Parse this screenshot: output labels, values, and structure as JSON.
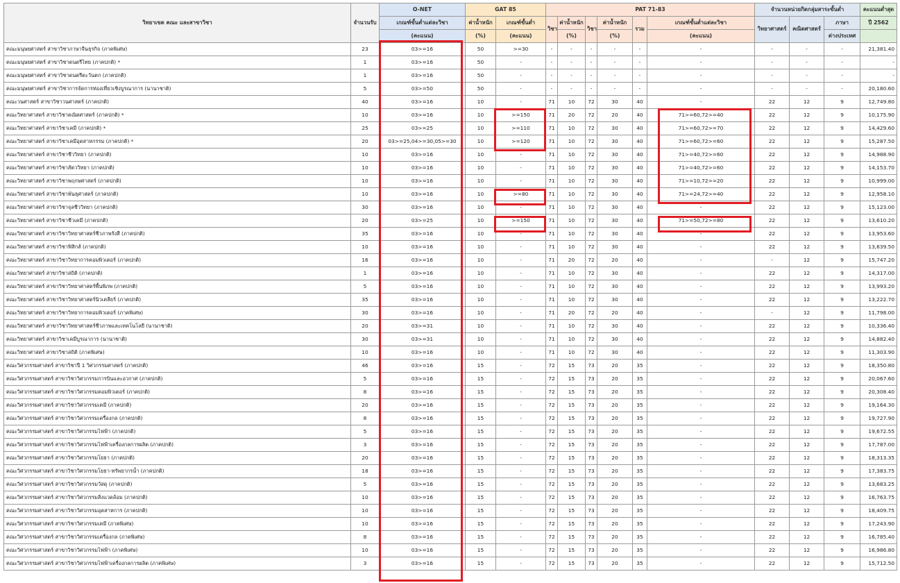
{
  "headers": {
    "program": "วิทยาเขต คณะ และสาขาวิชา",
    "seats": "จำนวนรับ",
    "onet": "O-NET",
    "onet_min": "เกณฑ์ขั้นต่ำแต่ละวิชา",
    "onet_unit": "(คะแนน)",
    "gat": "GAT 85",
    "gat_weight": "ค่าน้ำหนัก",
    "gat_weight_unit": "(%)",
    "gat_min": "เกณฑ์ขั้นต่ำ",
    "gat_min_unit": "(คะแนน)",
    "pat": "PAT 71-83",
    "subject": "วิชา",
    "weight": "ค่าน้ำหนัก",
    "weight_unit": "(%)",
    "total": "รวม",
    "pat_min": "เกณฑ์ขั้นต่ำแต่ละวิชา",
    "pat_min_unit": "(คะแนน)",
    "credits": "จำนวนหน่วยกิตกลุ่มสาระขั้นต่ำ",
    "science": "วิทยาศาสตร์",
    "math": "คณิตศาสตร์",
    "foreign": "ภาษา",
    "foreign2": "ต่างประเทศ",
    "min_score": "คะแนนต่ำสุด",
    "min_score_year": "ปี 2562"
  },
  "rows": [
    [
      "คณะมนุษยศาสตร์ สาขาวิชาภาษาจีนธุรกิจ (ภาคพิเศษ)",
      "23",
      "03>=16",
      "50",
      ">=30",
      "-",
      "-",
      "-",
      "-",
      "-",
      "-",
      "-",
      "-",
      "-",
      "21,381.40"
    ],
    [
      "คณะมนุษยศาสตร์ สาขาวิชาดนตรีไทย (ภาคปกติ) *",
      "1",
      "03>=16",
      "50",
      "-",
      "-",
      "-",
      "-",
      "-",
      "-",
      "-",
      "-",
      "-",
      "-",
      "-"
    ],
    [
      "คณะมนุษยศาสตร์ สาขาวิชาดนตรีตะวันตก (ภาคปกติ)",
      "1",
      "03>=16",
      "50",
      "-",
      "-",
      "-",
      "-",
      "-",
      "-",
      "-",
      "-",
      "-",
      "-",
      "-"
    ],
    [
      "คณะมนุษยศาสตร์ สาขาวิชาการจัดการท่องเที่ยวเชิงบูรณาการ (นานาชาติ)",
      "5",
      "03>=50",
      "50",
      "-",
      "-",
      "-",
      "-",
      "-",
      "-",
      "-",
      "-",
      "-",
      "-",
      "20,180.60"
    ],
    [
      "คณะวนศาสตร์ สาขาวิชาวนศาสตร์ (ภาคปกติ)",
      "40",
      "03>=16",
      "10",
      "-",
      "71",
      "10",
      "72",
      "30",
      "40",
      "-",
      "22",
      "12",
      "9",
      "12,749.80"
    ],
    [
      "คณะวิทยาศาสตร์ สาขาวิชาคณิตศาสตร์ (ภาคปกติ) *",
      "10",
      "03>=16",
      "10",
      ">=150",
      "71",
      "20",
      "72",
      "20",
      "40",
      "71>=60,72>=40",
      "22",
      "12",
      "9",
      "10,175.90"
    ],
    [
      "คณะวิทยาศาสตร์ สาขาวิชาเคมี (ภาคปกติ) *",
      "25",
      "03>=25",
      "10",
      ">=110",
      "71",
      "10",
      "72",
      "30",
      "40",
      "71>=60,72>=70",
      "22",
      "12",
      "9",
      "14,429.60"
    ],
    [
      "คณะวิทยาศาสตร์ สาขาวิชาเคมีอุตสาหกรรม (ภาคปกติ) *",
      "20",
      "03>=25,04>=30,05>=30",
      "10",
      ">=120",
      "71",
      "10",
      "72",
      "30",
      "40",
      "71>=60,72>=60",
      "22",
      "12",
      "9",
      "15,287.50"
    ],
    [
      "คณะวิทยาศาสตร์ สาขาวิชาชีววิทยา (ภาคปกติ)",
      "10",
      "03>=16",
      "10",
      "-",
      "71",
      "10",
      "72",
      "30",
      "40",
      "71>=40,72>=60",
      "22",
      "12",
      "9",
      "14,988.90"
    ],
    [
      "คณะวิทยาศาสตร์ สาขาวิชาสัตววิทยา (ภาคปกติ)",
      "10",
      "03>=16",
      "10",
      "-",
      "71",
      "10",
      "72",
      "30",
      "40",
      "71>=40,72>=60",
      "22",
      "12",
      "9",
      "14,153.70"
    ],
    [
      "คณะวิทยาศาสตร์ สาขาวิชาพฤกษศาสตร์ (ภาคปกติ)",
      "10",
      "03>=16",
      "10",
      "-",
      "71",
      "10",
      "72",
      "30",
      "40",
      "71>=10,72>=20",
      "22",
      "12",
      "9",
      "10,999.00"
    ],
    [
      "คณะวิทยาศาสตร์ สาขาวิชาพันธุศาสตร์ (ภาคปกติ)",
      "10",
      "03>=16",
      "10",
      ">=80",
      "71",
      "10",
      "72",
      "30",
      "40",
      "71>=24,72>=40",
      "22",
      "12",
      "9",
      "12,958.10"
    ],
    [
      "คณะวิทยาศาสตร์ สาขาวิชาจุลชีววิทยา (ภาคปกติ)",
      "30",
      "03>=16",
      "10",
      "-",
      "71",
      "10",
      "72",
      "30",
      "40",
      "-",
      "22",
      "12",
      "9",
      "15,123.00"
    ],
    [
      "คณะวิทยาศาสตร์ สาขาวิชาชีวเคมี (ภาคปกติ)",
      "20",
      "03>=25",
      "10",
      ">=150",
      "71",
      "10",
      "72",
      "30",
      "40",
      "71>=50,72>=80",
      "22",
      "12",
      "9",
      "13,610.20"
    ],
    [
      "คณะวิทยาศาสตร์ สาขาวิชาวิทยาศาสตร์ชีวภาพรังสี (ภาคปกติ)",
      "35",
      "03>=16",
      "10",
      "-",
      "71",
      "10",
      "72",
      "30",
      "40",
      "-",
      "22",
      "12",
      "9",
      "13,953.60"
    ],
    [
      "คณะวิทยาศาสตร์ สาขาวิชาฟิสิกส์ (ภาคปกติ)",
      "10",
      "03>=16",
      "10",
      "-",
      "71",
      "10",
      "72",
      "30",
      "40",
      "-",
      "22",
      "12",
      "9",
      "13,639.50"
    ],
    [
      "คณะวิทยาศาสตร์ สาขาวิชาวิทยาการคอมพิวเตอร์ (ภาคปกติ)",
      "16",
      "03>=16",
      "10",
      "-",
      "71",
      "20",
      "72",
      "20",
      "40",
      "-",
      "-",
      "12",
      "9",
      "15,747.20"
    ],
    [
      "คณะวิทยาศาสตร์ สาขาวิชาสถิติ (ภาคปกติ)",
      "1",
      "03>=16",
      "10",
      "-",
      "71",
      "10",
      "72",
      "30",
      "40",
      "-",
      "22",
      "12",
      "9",
      "14,317.00"
    ],
    [
      "คณะวิทยาศาสตร์ สาขาวิชาวิทยาศาสตร์พื้นพิภพ (ภาคปกติ)",
      "5",
      "03>=16",
      "10",
      "-",
      "71",
      "10",
      "72",
      "30",
      "40",
      "-",
      "22",
      "12",
      "9",
      "13,993.20"
    ],
    [
      "คณะวิทยาศาสตร์ สาขาวิชาวิทยาศาสตร์นิวเคลียร์ (ภาคปกติ)",
      "35",
      "03>=16",
      "10",
      "-",
      "71",
      "10",
      "72",
      "30",
      "40",
      "-",
      "22",
      "12",
      "9",
      "13,222.70"
    ],
    [
      "คณะวิทยาศาสตร์ สาขาวิชาวิทยาการคอมพิวเตอร์ (ภาคพิเศษ)",
      "30",
      "03>=16",
      "10",
      "-",
      "71",
      "20",
      "72",
      "20",
      "40",
      "-",
      "-",
      "12",
      "9",
      "11,798.00"
    ],
    [
      "คณะวิทยาศาสตร์ สาขาวิชาวิทยาศาสตร์ชีวภาพและเทคโนโลยี (นานาชาติ)",
      "20",
      "03>=31",
      "10",
      "-",
      "71",
      "10",
      "72",
      "30",
      "40",
      "-",
      "22",
      "12",
      "9",
      "10,336.40"
    ],
    [
      "คณะวิทยาศาสตร์ สาขาวิชาเคมีบูรณาการ (นานาชาติ)",
      "30",
      "03>=31",
      "10",
      "-",
      "71",
      "10",
      "72",
      "30",
      "40",
      "-",
      "22",
      "12",
      "9",
      "14,882.40"
    ],
    [
      "คณะวิทยาศาสตร์ สาขาวิชาสถิติ (ภาคพิเศษ)",
      "10",
      "03>=16",
      "10",
      "-",
      "71",
      "10",
      "72",
      "30",
      "40",
      "-",
      "22",
      "12",
      "9",
      "11,303.90"
    ],
    [
      "คณะวิศวกรรมศาสตร์ สาขาวิชาปี 1 วิศวกรรมศาสตร์ (ภาคปกติ)",
      "46",
      "03>=16",
      "15",
      "-",
      "72",
      "15",
      "73",
      "20",
      "35",
      "-",
      "22",
      "12",
      "9",
      "18,350.80"
    ],
    [
      "คณะวิศวกรรมศาสตร์ สาขาวิชาวิศวกรรมการบินและอวกาศ (ภาคปกติ)",
      "5",
      "03>=16",
      "15",
      "-",
      "72",
      "15",
      "73",
      "20",
      "35",
      "-",
      "22",
      "12",
      "9",
      "20,067.60"
    ],
    [
      "คณะวิศวกรรมศาสตร์ สาขาวิชาวิศวกรรมคอมพิวเตอร์ (ภาคปกติ)",
      "8",
      "03>=16",
      "15",
      "-",
      "72",
      "15",
      "73",
      "20",
      "35",
      "-",
      "22",
      "12",
      "9",
      "20,308.40"
    ],
    [
      "คณะวิศวกรรมศาสตร์ สาขาวิชาวิศวกรรมเคมี (ภาคปกติ)",
      "20",
      "03>=16",
      "15",
      "-",
      "72",
      "15",
      "73",
      "20",
      "35",
      "-",
      "22",
      "12",
      "9",
      "19,164.30"
    ],
    [
      "คณะวิศวกรรมศาสตร์ สาขาวิชาวิศวกรรมเครื่องกล (ภาคปกติ)",
      "8",
      "03>=16",
      "15",
      "-",
      "72",
      "15",
      "73",
      "20",
      "35",
      "-",
      "22",
      "12",
      "9",
      "19,727.90"
    ],
    [
      "คณะวิศวกรรมศาสตร์ สาขาวิชาวิศวกรรมไฟฟ้า (ภาคปกติ)",
      "5",
      "03>=16",
      "15",
      "-",
      "72",
      "15",
      "73",
      "20",
      "35",
      "-",
      "22",
      "12",
      "9",
      "19,672.55"
    ],
    [
      "คณะวิศวกรรมศาสตร์ สาขาวิชาวิศวกรรมไฟฟ้าเครื่องกลการผลิต (ภาคปกติ)",
      "3",
      "03>=16",
      "15",
      "-",
      "72",
      "15",
      "73",
      "20",
      "35",
      "-",
      "22",
      "12",
      "9",
      "17,787.00"
    ],
    [
      "คณะวิศวกรรมศาสตร์ สาขาวิชาวิศวกรรมโยธา (ภาคปกติ)",
      "20",
      "03>=16",
      "15",
      "-",
      "72",
      "15",
      "73",
      "20",
      "35",
      "-",
      "22",
      "12",
      "9",
      "18,313.35"
    ],
    [
      "คณะวิศวกรรมศาสตร์ สาขาวิชาวิศวกรรมโยธา-ทรัพยากรน้ำ (ภาคปกติ)",
      "18",
      "03>=16",
      "15",
      "-",
      "72",
      "15",
      "73",
      "20",
      "35",
      "-",
      "22",
      "12",
      "9",
      "17,383.75"
    ],
    [
      "คณะวิศวกรรมศาสตร์ สาขาวิชาวิศวกรรมวัสดุ (ภาคปกติ)",
      "5",
      "03>=16",
      "15",
      "-",
      "72",
      "15",
      "73",
      "20",
      "35",
      "-",
      "22",
      "12",
      "9",
      "13,683.25"
    ],
    [
      "คณะวิศวกรรมศาสตร์ สาขาวิชาวิศวกรรมสิ่งแวดล้อม (ภาคปกติ)",
      "10",
      "03>=16",
      "15",
      "-",
      "72",
      "15",
      "73",
      "20",
      "35",
      "-",
      "22",
      "12",
      "9",
      "16,763.75"
    ],
    [
      "คณะวิศวกรรมศาสตร์ สาขาวิชาวิศวกรรมอุตสาหการ (ภาคปกติ)",
      "10",
      "03>=16",
      "15",
      "-",
      "72",
      "15",
      "73",
      "20",
      "35",
      "-",
      "22",
      "12",
      "9",
      "18,409.75"
    ],
    [
      "คณะวิศวกรรมศาสตร์ สาขาวิชาวิศวกรรมเคมี (ภาคพิเศษ)",
      "10",
      "03>=16",
      "15",
      "-",
      "72",
      "15",
      "73",
      "20",
      "35",
      "-",
      "22",
      "12",
      "9",
      "17,243.90"
    ],
    [
      "คณะวิศวกรรมศาสตร์ สาขาวิชาวิศวกรรมเครื่องกล (ภาคพิเศษ)",
      "8",
      "03>=16",
      "15",
      "-",
      "72",
      "15",
      "73",
      "20",
      "35",
      "-",
      "22",
      "12",
      "9",
      "16,785.40"
    ],
    [
      "คณะวิศวกรรมศาสตร์ สาขาวิชาวิศวกรรมไฟฟ้า (ภาคพิเศษ)",
      "10",
      "03>=16",
      "15",
      "-",
      "72",
      "15",
      "73",
      "20",
      "35",
      "-",
      "22",
      "12",
      "9",
      "16,986.80"
    ],
    [
      "คณะวิศวกรรมศาสตร์ สาขาวิชาวิศวกรรมไฟฟ้าเครื่องกลการผลิต (ภาคพิเศษ)",
      "3",
      "03>=16",
      "15",
      "-",
      "72",
      "15",
      "73",
      "20",
      "35",
      "-",
      "22",
      "12",
      "9",
      "15,712.50"
    ]
  ]
}
